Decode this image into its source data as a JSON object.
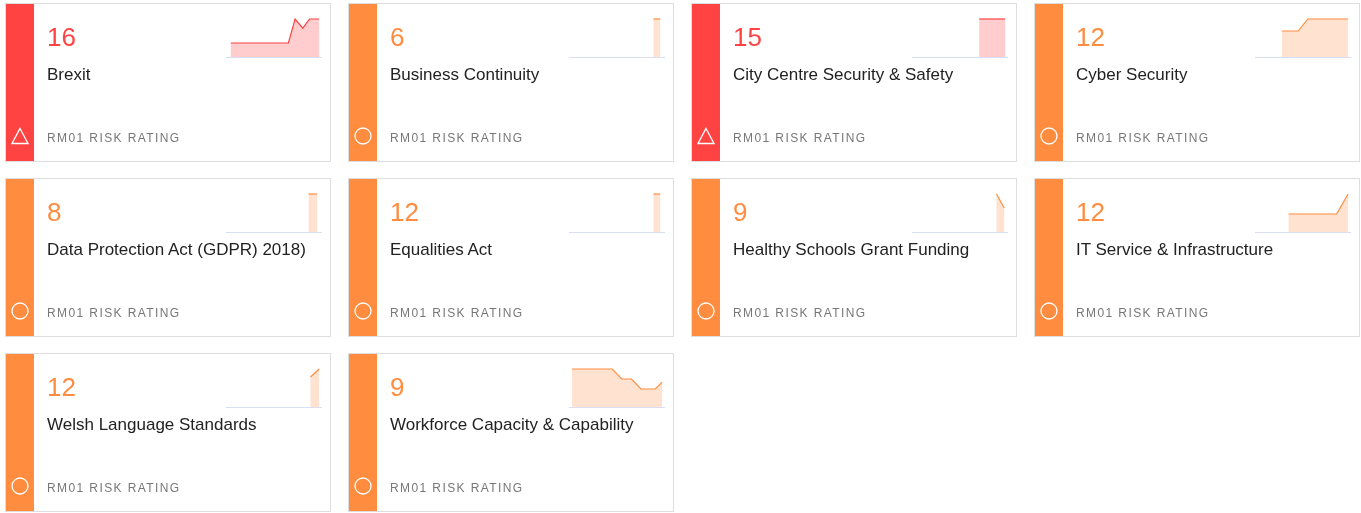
{
  "cards": [
    {
      "score": "16",
      "title": "Brexit",
      "label": "RM01 RISK RATING",
      "kind": "high"
    },
    {
      "score": "6",
      "title": "Business Continuity",
      "label": "RM01 RISK RATING",
      "kind": "medium"
    },
    {
      "score": "15",
      "title": "City Centre Security & Safety",
      "label": "RM01 RISK RATING",
      "kind": "high"
    },
    {
      "score": "12",
      "title": "Cyber Security",
      "label": "RM01 RISK RATING",
      "kind": "medium"
    },
    {
      "score": "8",
      "title": "Data Protection Act (GDPR) 2018)",
      "label": "RM01 RISK RATING",
      "kind": "medium"
    },
    {
      "score": "12",
      "title": "Equalities Act",
      "label": "RM01 RISK RATING",
      "kind": "medium"
    },
    {
      "score": "9",
      "title": "Healthy Schools Grant Funding",
      "label": "RM01 RISK RATING",
      "kind": "medium"
    },
    {
      "score": "12",
      "title": "IT Service & Infrastructure",
      "label": "RM01 RISK RATING",
      "kind": "medium"
    },
    {
      "score": "12",
      "title": "Welsh Language Standards",
      "label": "RM01 RISK RATING",
      "kind": "medium"
    },
    {
      "score": "9",
      "title": "Workforce Capacity & Capability",
      "label": "RM01 RISK RATING",
      "kind": "medium"
    }
  ]
}
